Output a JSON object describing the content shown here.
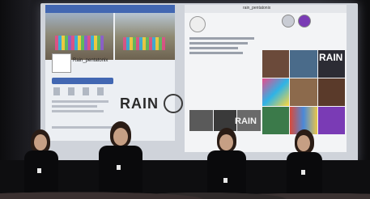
{
  "slide": {
    "fb_page_name": "Rain_pentatonix",
    "ig_username": "rain_pentatonix",
    "rain_logo_left": "RAIN",
    "rain_logo_right": "RAIN",
    "rain_logo_mid": "RAIN"
  },
  "colors": {
    "facebook_blue": "#4267b2",
    "screen_bg": "#cfd3da",
    "stage_dark": "#0e0e10"
  },
  "presenters": 4
}
